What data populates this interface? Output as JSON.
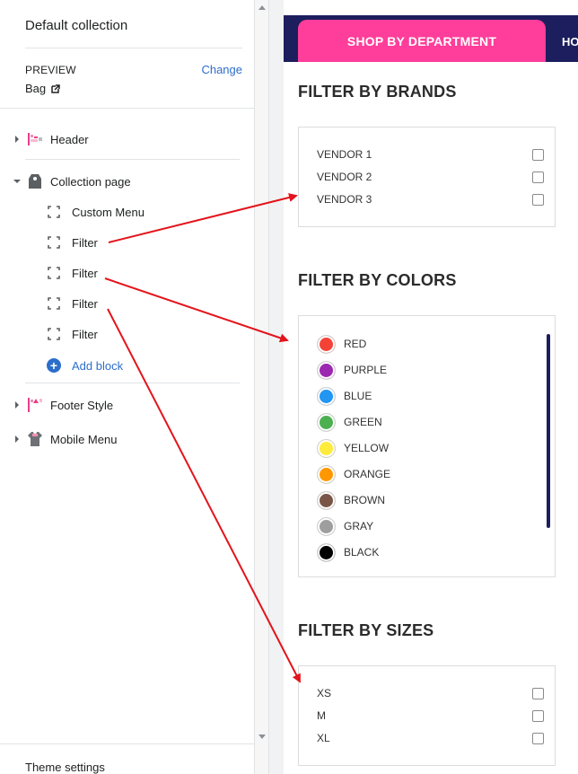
{
  "sidebar": {
    "title": "Default collection",
    "preview_label": "PREVIEW",
    "change_label": "Change",
    "preview_value": "Bag",
    "sections": [
      {
        "label": "Header",
        "icon": "header-icon",
        "expanded": false
      },
      {
        "label": "Collection page",
        "icon": "tag-icon",
        "expanded": true
      },
      {
        "label": "Footer Style",
        "icon": "footer-icon",
        "expanded": false
      },
      {
        "label": "Mobile Menu",
        "icon": "shirt-icon",
        "expanded": false
      }
    ],
    "collection_children": [
      "Custom Menu",
      "Filter",
      "Filter",
      "Filter",
      "Filter"
    ],
    "add_block_label": "Add block",
    "theme_settings_label": "Theme settings"
  },
  "preview": {
    "nav_button": "SHOP BY DEPARTMENT",
    "nav_more": "HO",
    "brands": {
      "title": "FILTER BY BRANDS",
      "options": [
        "VENDOR 1",
        "VENDOR 2",
        "VENDOR 3"
      ]
    },
    "colors": {
      "title": "FILTER BY COLORS",
      "options": [
        {
          "label": "RED",
          "color": "#f44336"
        },
        {
          "label": "PURPLE",
          "color": "#9c27b0"
        },
        {
          "label": "BLUE",
          "color": "#2196f3"
        },
        {
          "label": "GREEN",
          "color": "#4caf50"
        },
        {
          "label": "YELLOW",
          "color": "#ffeb3b"
        },
        {
          "label": "ORANGE",
          "color": "#ff9800"
        },
        {
          "label": "BROWN",
          "color": "#795548"
        },
        {
          "label": "GRAY",
          "color": "#9e9e9e"
        },
        {
          "label": "BLACK",
          "color": "#000000"
        }
      ]
    },
    "sizes": {
      "title": "FILTER BY SIZES",
      "options": [
        "XS",
        "M",
        "XL"
      ]
    }
  },
  "colors": {
    "accent_link": "#2c6ecb",
    "nav_bg": "#1d1e5d",
    "nav_button_bg": "#ff3d9a",
    "annotation_arrow": "#e3141b"
  }
}
